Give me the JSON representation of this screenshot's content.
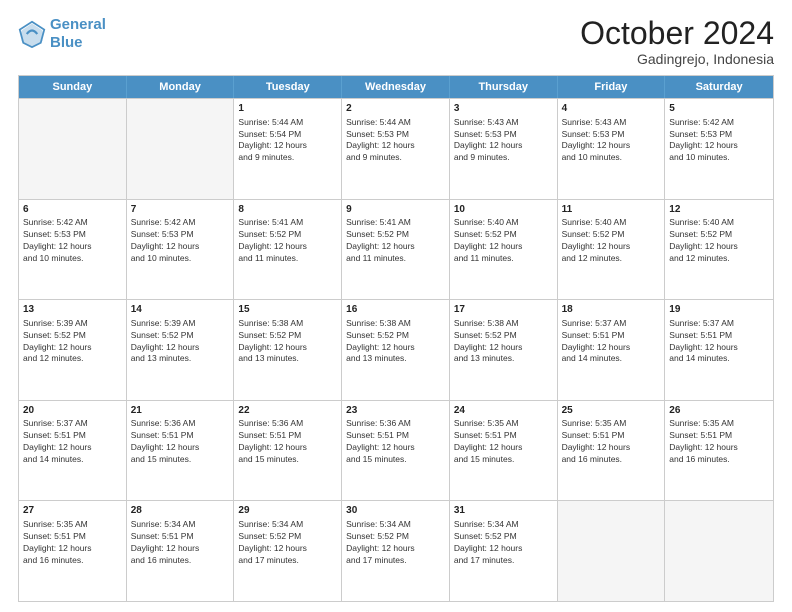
{
  "header": {
    "logo_line1": "General",
    "logo_line2": "Blue",
    "month": "October 2024",
    "location": "Gadingrejo, Indonesia"
  },
  "days_of_week": [
    "Sunday",
    "Monday",
    "Tuesday",
    "Wednesday",
    "Thursday",
    "Friday",
    "Saturday"
  ],
  "weeks": [
    [
      {
        "day": "",
        "info": "",
        "shaded": true
      },
      {
        "day": "",
        "info": "",
        "shaded": true
      },
      {
        "day": "1",
        "info": "Sunrise: 5:44 AM\nSunset: 5:54 PM\nDaylight: 12 hours\nand 9 minutes.",
        "shaded": false
      },
      {
        "day": "2",
        "info": "Sunrise: 5:44 AM\nSunset: 5:53 PM\nDaylight: 12 hours\nand 9 minutes.",
        "shaded": false
      },
      {
        "day": "3",
        "info": "Sunrise: 5:43 AM\nSunset: 5:53 PM\nDaylight: 12 hours\nand 9 minutes.",
        "shaded": false
      },
      {
        "day": "4",
        "info": "Sunrise: 5:43 AM\nSunset: 5:53 PM\nDaylight: 12 hours\nand 10 minutes.",
        "shaded": false
      },
      {
        "day": "5",
        "info": "Sunrise: 5:42 AM\nSunset: 5:53 PM\nDaylight: 12 hours\nand 10 minutes.",
        "shaded": false
      }
    ],
    [
      {
        "day": "6",
        "info": "Sunrise: 5:42 AM\nSunset: 5:53 PM\nDaylight: 12 hours\nand 10 minutes.",
        "shaded": false
      },
      {
        "day": "7",
        "info": "Sunrise: 5:42 AM\nSunset: 5:53 PM\nDaylight: 12 hours\nand 10 minutes.",
        "shaded": false
      },
      {
        "day": "8",
        "info": "Sunrise: 5:41 AM\nSunset: 5:52 PM\nDaylight: 12 hours\nand 11 minutes.",
        "shaded": false
      },
      {
        "day": "9",
        "info": "Sunrise: 5:41 AM\nSunset: 5:52 PM\nDaylight: 12 hours\nand 11 minutes.",
        "shaded": false
      },
      {
        "day": "10",
        "info": "Sunrise: 5:40 AM\nSunset: 5:52 PM\nDaylight: 12 hours\nand 11 minutes.",
        "shaded": false
      },
      {
        "day": "11",
        "info": "Sunrise: 5:40 AM\nSunset: 5:52 PM\nDaylight: 12 hours\nand 12 minutes.",
        "shaded": false
      },
      {
        "day": "12",
        "info": "Sunrise: 5:40 AM\nSunset: 5:52 PM\nDaylight: 12 hours\nand 12 minutes.",
        "shaded": false
      }
    ],
    [
      {
        "day": "13",
        "info": "Sunrise: 5:39 AM\nSunset: 5:52 PM\nDaylight: 12 hours\nand 12 minutes.",
        "shaded": false
      },
      {
        "day": "14",
        "info": "Sunrise: 5:39 AM\nSunset: 5:52 PM\nDaylight: 12 hours\nand 13 minutes.",
        "shaded": false
      },
      {
        "day": "15",
        "info": "Sunrise: 5:38 AM\nSunset: 5:52 PM\nDaylight: 12 hours\nand 13 minutes.",
        "shaded": false
      },
      {
        "day": "16",
        "info": "Sunrise: 5:38 AM\nSunset: 5:52 PM\nDaylight: 12 hours\nand 13 minutes.",
        "shaded": false
      },
      {
        "day": "17",
        "info": "Sunrise: 5:38 AM\nSunset: 5:52 PM\nDaylight: 12 hours\nand 13 minutes.",
        "shaded": false
      },
      {
        "day": "18",
        "info": "Sunrise: 5:37 AM\nSunset: 5:51 PM\nDaylight: 12 hours\nand 14 minutes.",
        "shaded": false
      },
      {
        "day": "19",
        "info": "Sunrise: 5:37 AM\nSunset: 5:51 PM\nDaylight: 12 hours\nand 14 minutes.",
        "shaded": false
      }
    ],
    [
      {
        "day": "20",
        "info": "Sunrise: 5:37 AM\nSunset: 5:51 PM\nDaylight: 12 hours\nand 14 minutes.",
        "shaded": false
      },
      {
        "day": "21",
        "info": "Sunrise: 5:36 AM\nSunset: 5:51 PM\nDaylight: 12 hours\nand 15 minutes.",
        "shaded": false
      },
      {
        "day": "22",
        "info": "Sunrise: 5:36 AM\nSunset: 5:51 PM\nDaylight: 12 hours\nand 15 minutes.",
        "shaded": false
      },
      {
        "day": "23",
        "info": "Sunrise: 5:36 AM\nSunset: 5:51 PM\nDaylight: 12 hours\nand 15 minutes.",
        "shaded": false
      },
      {
        "day": "24",
        "info": "Sunrise: 5:35 AM\nSunset: 5:51 PM\nDaylight: 12 hours\nand 15 minutes.",
        "shaded": false
      },
      {
        "day": "25",
        "info": "Sunrise: 5:35 AM\nSunset: 5:51 PM\nDaylight: 12 hours\nand 16 minutes.",
        "shaded": false
      },
      {
        "day": "26",
        "info": "Sunrise: 5:35 AM\nSunset: 5:51 PM\nDaylight: 12 hours\nand 16 minutes.",
        "shaded": false
      }
    ],
    [
      {
        "day": "27",
        "info": "Sunrise: 5:35 AM\nSunset: 5:51 PM\nDaylight: 12 hours\nand 16 minutes.",
        "shaded": false
      },
      {
        "day": "28",
        "info": "Sunrise: 5:34 AM\nSunset: 5:51 PM\nDaylight: 12 hours\nand 16 minutes.",
        "shaded": false
      },
      {
        "day": "29",
        "info": "Sunrise: 5:34 AM\nSunset: 5:52 PM\nDaylight: 12 hours\nand 17 minutes.",
        "shaded": false
      },
      {
        "day": "30",
        "info": "Sunrise: 5:34 AM\nSunset: 5:52 PM\nDaylight: 12 hours\nand 17 minutes.",
        "shaded": false
      },
      {
        "day": "31",
        "info": "Sunrise: 5:34 AM\nSunset: 5:52 PM\nDaylight: 12 hours\nand 17 minutes.",
        "shaded": false
      },
      {
        "day": "",
        "info": "",
        "shaded": true
      },
      {
        "day": "",
        "info": "",
        "shaded": true
      }
    ]
  ]
}
